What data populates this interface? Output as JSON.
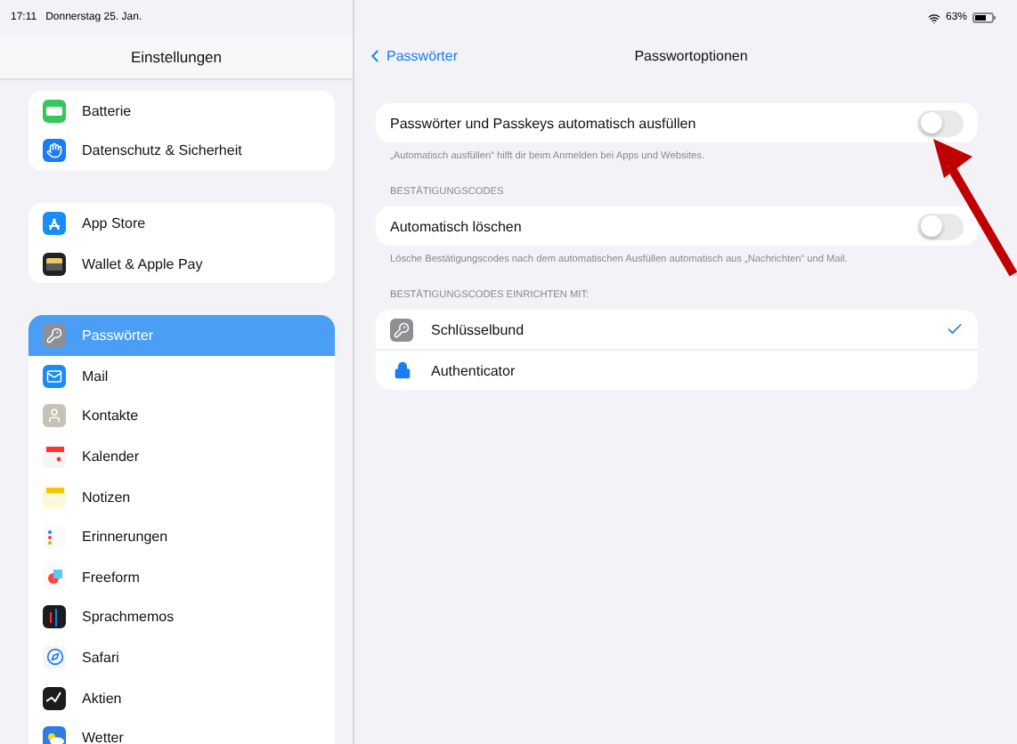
{
  "status_bar": {
    "time": "17:11",
    "date": "Donnerstag 25. Jan.",
    "battery": "63%"
  },
  "sidebar": {
    "title": "Einstellungen",
    "groups": [
      [
        {
          "label": "Batterie",
          "kind": "battery",
          "selected": false
        },
        {
          "label": "Datenschutz & Sicherheit",
          "kind": "hand",
          "selected": false
        }
      ],
      [
        {
          "label": "App Store",
          "kind": "appstore",
          "selected": false
        },
        {
          "label": "Wallet & Apple Pay",
          "kind": "wallet",
          "selected": false
        }
      ],
      [
        {
          "label": "Passwörter",
          "kind": "key",
          "selected": true
        },
        {
          "label": "Mail",
          "kind": "mail",
          "selected": false
        },
        {
          "label": "Kontakte",
          "kind": "contacts",
          "selected": false
        },
        {
          "label": "Kalender",
          "kind": "calendar",
          "selected": false
        },
        {
          "label": "Notizen",
          "kind": "notes",
          "selected": false
        },
        {
          "label": "Erinnerungen",
          "kind": "reminders",
          "selected": false
        },
        {
          "label": "Freeform",
          "kind": "freeform",
          "selected": false
        },
        {
          "label": "Sprachmemos",
          "kind": "voice",
          "selected": false
        },
        {
          "label": "Safari",
          "kind": "safari",
          "selected": false
        },
        {
          "label": "Aktien",
          "kind": "stocks",
          "selected": false
        },
        {
          "label": "Wetter",
          "kind": "weather",
          "selected": false
        }
      ]
    ]
  },
  "detail": {
    "back": "Passwörter",
    "title": "Passwortoptionen",
    "sections": [
      {
        "kind": "toggle",
        "rows": [
          {
            "label": "Passwörter und Passkeys automatisch ausfüllen",
            "on": false
          }
        ],
        "footer": "„Automatisch ausfüllen“ hilft dir beim Anmelden bei Apps und Websites."
      },
      {
        "kind": "toggle",
        "header": "BESTÄTIGUNGSCODES",
        "rows": [
          {
            "label": "Automatisch löschen",
            "on": false
          }
        ],
        "footer": "Lösche Bestätigungscodes nach dem automatischen Ausfüllen automatisch aus „Nachrichten“ und Mail."
      },
      {
        "kind": "choice",
        "header": "BESTÄTIGUNGSCODES EINRICHTEN MIT:",
        "rows": [
          {
            "label": "Schlüsselbund",
            "kind": "key",
            "selected": true
          },
          {
            "label": "Authenticator",
            "kind": "lock",
            "selected": false
          }
        ]
      }
    ]
  }
}
